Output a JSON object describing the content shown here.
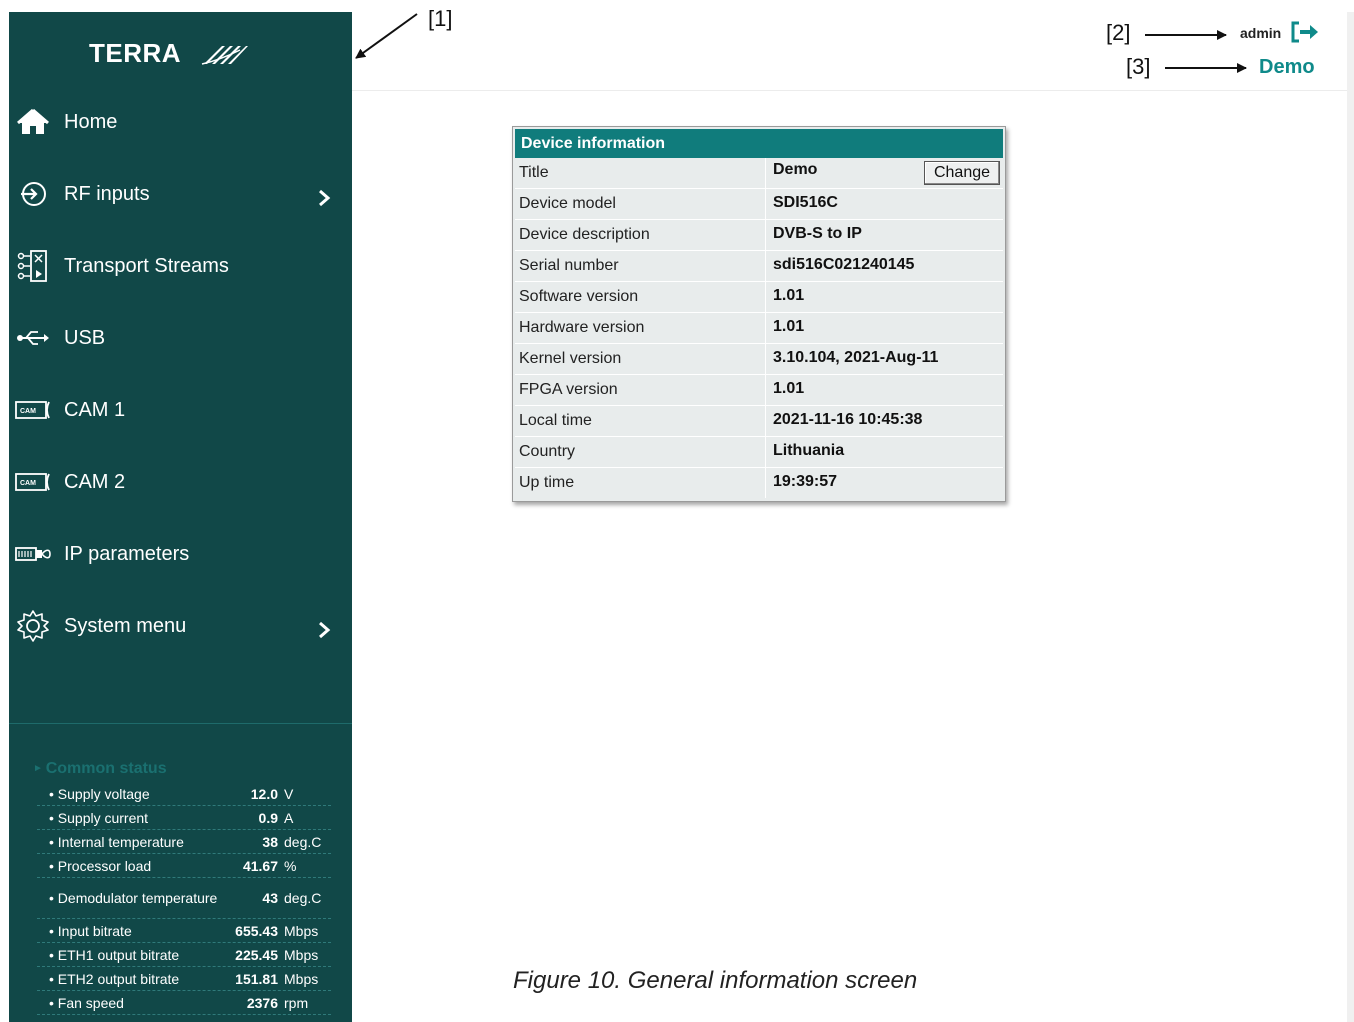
{
  "annotations": {
    "a1": "[1]",
    "a2": "[2]",
    "a3": "[3]"
  },
  "header": {
    "user": "admin",
    "device_title": "Demo",
    "logout_icon": "logout-arrow-icon"
  },
  "sidebar": {
    "logo": "TERRA",
    "items": [
      {
        "label": "Home",
        "icon": "home-icon"
      },
      {
        "label": "RF inputs",
        "icon": "rf-input-icon",
        "has_submenu": true
      },
      {
        "label": "Transport Streams",
        "icon": "transport-streams-icon"
      },
      {
        "label": "USB",
        "icon": "usb-icon"
      },
      {
        "label": "CAM 1",
        "icon": "cam-icon"
      },
      {
        "label": "CAM 2",
        "icon": "cam-icon"
      },
      {
        "label": "IP parameters",
        "icon": "ethernet-icon"
      },
      {
        "label": "System menu",
        "icon": "gear-icon",
        "has_submenu": true
      }
    ],
    "status": {
      "title": "Common status",
      "rows": [
        {
          "name": "• Supply voltage",
          "value": "12.0",
          "unit": "V"
        },
        {
          "name": "• Supply current",
          "value": "0.9",
          "unit": "A"
        },
        {
          "name": "• Internal temperature",
          "value": "38",
          "unit": "deg.C"
        },
        {
          "name": "• Processor load",
          "value": "41.67",
          "unit": "%"
        },
        {
          "name": "• Demodulator temperature",
          "value": "43",
          "unit": "deg.C"
        },
        {
          "name": "• Input bitrate",
          "value": "655.43",
          "unit": "Mbps"
        },
        {
          "name": "• ETH1 output bitrate",
          "value": "225.45",
          "unit": "Mbps"
        },
        {
          "name": "• ETH2 output bitrate",
          "value": "151.81",
          "unit": "Mbps"
        },
        {
          "name": "• Fan speed",
          "value": "2376",
          "unit": "rpm"
        }
      ]
    }
  },
  "device_info": {
    "header": "Device information",
    "change_label": "Change",
    "rows": [
      {
        "label": "Title",
        "value": "Demo"
      },
      {
        "label": "Device model",
        "value": "SDI516C"
      },
      {
        "label": "Device description",
        "value": "DVB-S to IP"
      },
      {
        "label": "Serial number",
        "value": "sdi516C021240145"
      },
      {
        "label": "Software version",
        "value": "1.01"
      },
      {
        "label": "Hardware version",
        "value": "1.01"
      },
      {
        "label": "Kernel version",
        "value": "3.10.104, 2021-Aug-11"
      },
      {
        "label": "FPGA version",
        "value": "1.01"
      },
      {
        "label": "Local time",
        "value": "2021-11-16 10:45:38"
      },
      {
        "label": "Country",
        "value": "Lithuania"
      },
      {
        "label": "Up time",
        "value": "19:39:57"
      }
    ]
  },
  "caption": "Figure 10. General information screen"
}
